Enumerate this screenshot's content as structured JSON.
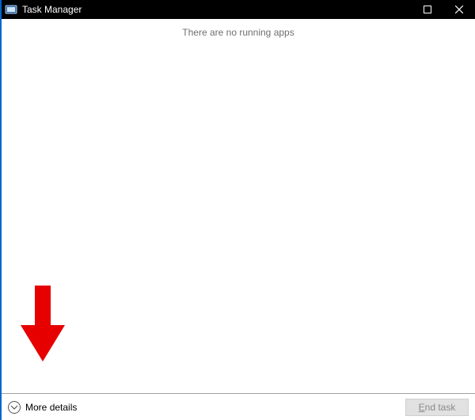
{
  "titlebar": {
    "title": "Task Manager"
  },
  "content": {
    "empty_message": "There are no running apps"
  },
  "footer": {
    "more_details_label": "More details",
    "end_task_label": "End task"
  },
  "annotation": {
    "arrow_color": "#e60000"
  }
}
